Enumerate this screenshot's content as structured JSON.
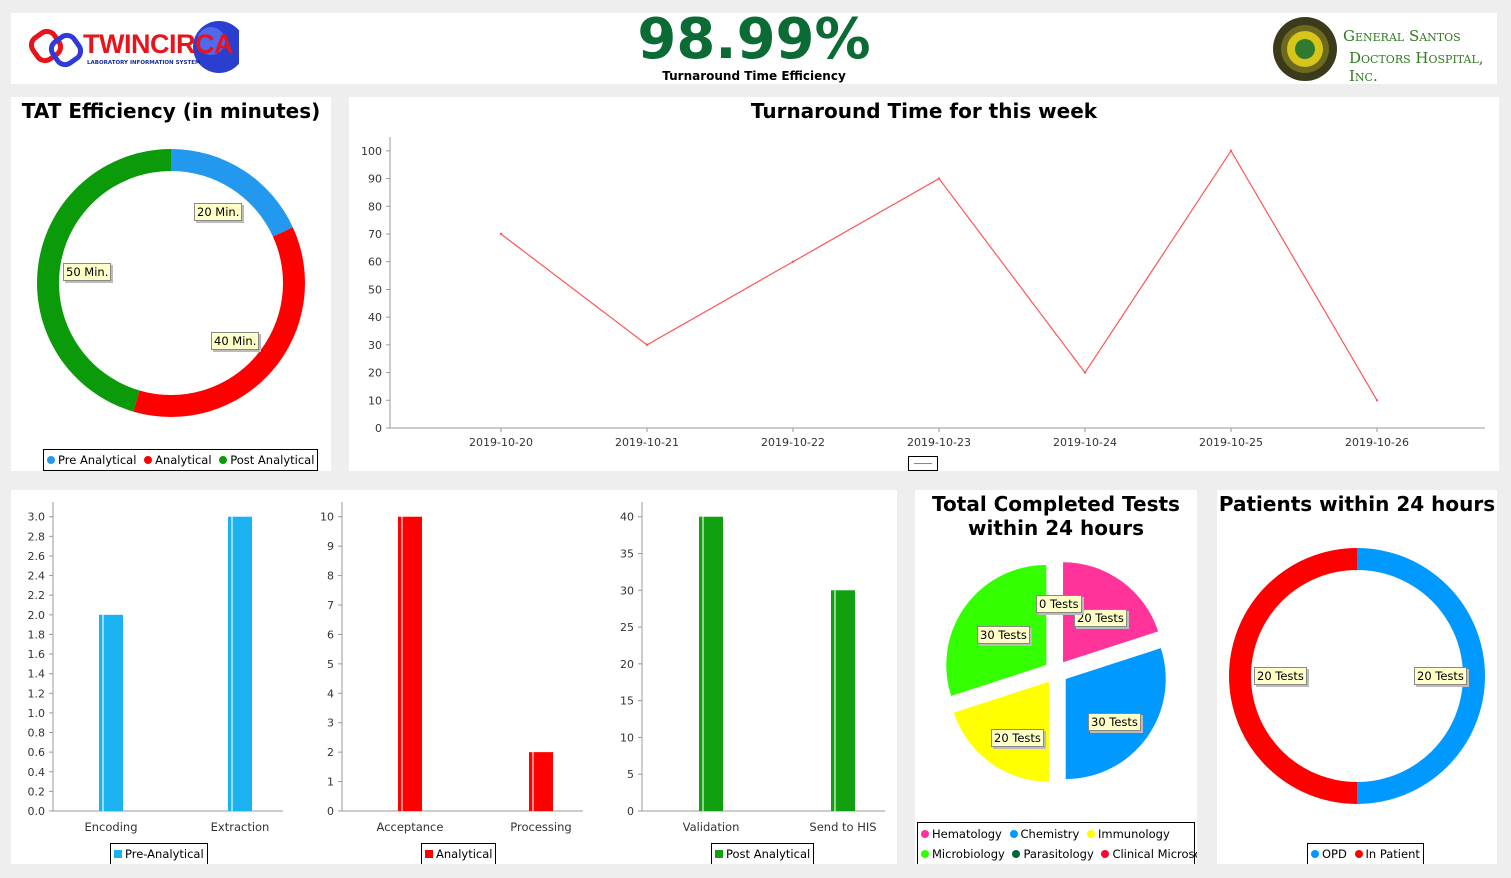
{
  "header": {
    "brand_name": "TWINCIRCA",
    "brand_sub": "LABORATORY INFORMATION SYSTEM",
    "efficiency_value": "98.99%",
    "efficiency_label": "Turnaround Time Efficiency",
    "hospital_line1": "General Santos",
    "hospital_line2": "Doctors Hospital, Inc.",
    "efficiency_color": "#0a6b34"
  },
  "panels": {
    "tat_title": "TAT Efficiency (in minutes)",
    "week_title": "Turnaround Time for this week",
    "tests_title_line1": "Total Completed Tests",
    "tests_title_line2": "within 24 hours",
    "patients_title": "Patients within 24 hours"
  },
  "chart_data": [
    {
      "id": "tat",
      "type": "pie",
      "title": "TAT Efficiency (in minutes)",
      "slices": [
        {
          "label": "Pre Analytical",
          "value": 20,
          "display": "20 Min.",
          "color": "#2299ee"
        },
        {
          "label": "Analytical",
          "value": 40,
          "display": "40 Min.",
          "color": "#ff0000"
        },
        {
          "label": "Post Analytical",
          "value": 50,
          "display": "50 Min.",
          "color": "#0a9a0a"
        }
      ]
    },
    {
      "id": "week",
      "type": "line",
      "title": "Turnaround Time for this week",
      "x": [
        "2019-10-20",
        "2019-10-21",
        "2019-10-22",
        "2019-10-23",
        "2019-10-24",
        "2019-10-25",
        "2019-10-26"
      ],
      "series": [
        {
          "values": [
            70,
            30,
            60,
            90,
            20,
            100,
            10
          ],
          "color": "#ff5555"
        }
      ],
      "ylim": [
        0,
        105
      ],
      "yticks": [
        0,
        10,
        20,
        30,
        40,
        50,
        60,
        70,
        80,
        90,
        100
      ],
      "grid": false
    },
    {
      "id": "pre",
      "type": "bar",
      "categories": [
        "Encoding",
        "Extraction"
      ],
      "series": [
        {
          "name": "Pre-Analytical",
          "values": [
            2,
            3
          ],
          "color": "#1ab2f0"
        }
      ],
      "ylim": [
        0,
        3.15
      ],
      "yticks": [
        "0.0",
        "0.2",
        "0.4",
        "0.6",
        "0.8",
        "1.0",
        "1.2",
        "1.4",
        "1.6",
        "1.8",
        "2.0",
        "2.2",
        "2.4",
        "2.6",
        "2.8",
        "3.0"
      ]
    },
    {
      "id": "ana",
      "type": "bar",
      "categories": [
        "Acceptance",
        "Processing"
      ],
      "series": [
        {
          "name": "Analytical",
          "values": [
            10,
            2
          ],
          "color": "#ff0000"
        }
      ],
      "ylim": [
        0,
        10.5
      ],
      "yticks": [
        "0",
        "1",
        "2",
        "3",
        "4",
        "5",
        "6",
        "7",
        "8",
        "9",
        "10"
      ]
    },
    {
      "id": "post",
      "type": "bar",
      "categories": [
        "Validation",
        "Send to HIS"
      ],
      "series": [
        {
          "name": "Post Analytical",
          "values": [
            40,
            30
          ],
          "color": "#10a010"
        }
      ],
      "ylim": [
        0,
        42
      ],
      "yticks": [
        "0",
        "5",
        "10",
        "15",
        "20",
        "25",
        "30",
        "35",
        "40"
      ]
    },
    {
      "id": "tests",
      "type": "pie",
      "title": "Total Completed Tests within 24 hours",
      "slices": [
        {
          "label": "Hematology",
          "value": 20,
          "display": "20 Tests",
          "color": "#ff3399"
        },
        {
          "label": "Chemistry",
          "value": 30,
          "display": "30 Tests",
          "color": "#0099ff"
        },
        {
          "label": "Immunology",
          "value": 20,
          "display": "20 Tests",
          "color": "#ffff00"
        },
        {
          "label": "Microbiology",
          "value": 30,
          "display": "30 Tests",
          "color": "#33ff00"
        },
        {
          "label": "Parasitology",
          "value": 0,
          "display": "0 Tests",
          "color": "#006633"
        },
        {
          "label": "Clinical Microscopy",
          "value": 0,
          "display": "",
          "color": "#ff0033"
        }
      ]
    },
    {
      "id": "patients",
      "type": "pie",
      "title": "Patients within 24 hours",
      "slices": [
        {
          "label": "OPD",
          "value": 20,
          "display": "20 Tests",
          "color": "#0099ff"
        },
        {
          "label": "In Patient",
          "value": 20,
          "display": "20 Tests",
          "color": "#ff0000"
        }
      ]
    }
  ]
}
